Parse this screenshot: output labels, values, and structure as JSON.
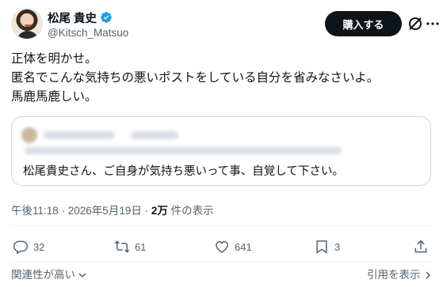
{
  "author": {
    "display_name": "松尾 貴史",
    "handle": "@Kitsch_Matsuo",
    "verified_color": "#1d9bf0"
  },
  "header": {
    "buy_label": "購入する"
  },
  "post": {
    "lines": [
      "正体を明かせ。",
      "匿名でこんな気持ちの悪いポストをしている自分を省みなさいよ。",
      "馬鹿馬鹿しい。"
    ]
  },
  "quote": {
    "text": "松尾貴史さん、ご自身が気持ち悪いって事、自覚して下さい。"
  },
  "meta": {
    "timestamp": "午後11:18 · 2026年5月19日 · ",
    "views_count": "2万",
    "views_label": " 件の表示"
  },
  "actions": {
    "replies": "32",
    "reposts": "61",
    "likes": "641",
    "bookmarks": "3"
  },
  "footer": {
    "relevance": "関連性が高い",
    "quotes": "引用を表示"
  },
  "icons": [
    "verified-badge-icon",
    "grok-icon",
    "more-icon",
    "reply-icon",
    "repost-icon",
    "like-icon",
    "bookmark-icon",
    "share-icon",
    "chevron-down-icon",
    "chevron-right-icon"
  ]
}
